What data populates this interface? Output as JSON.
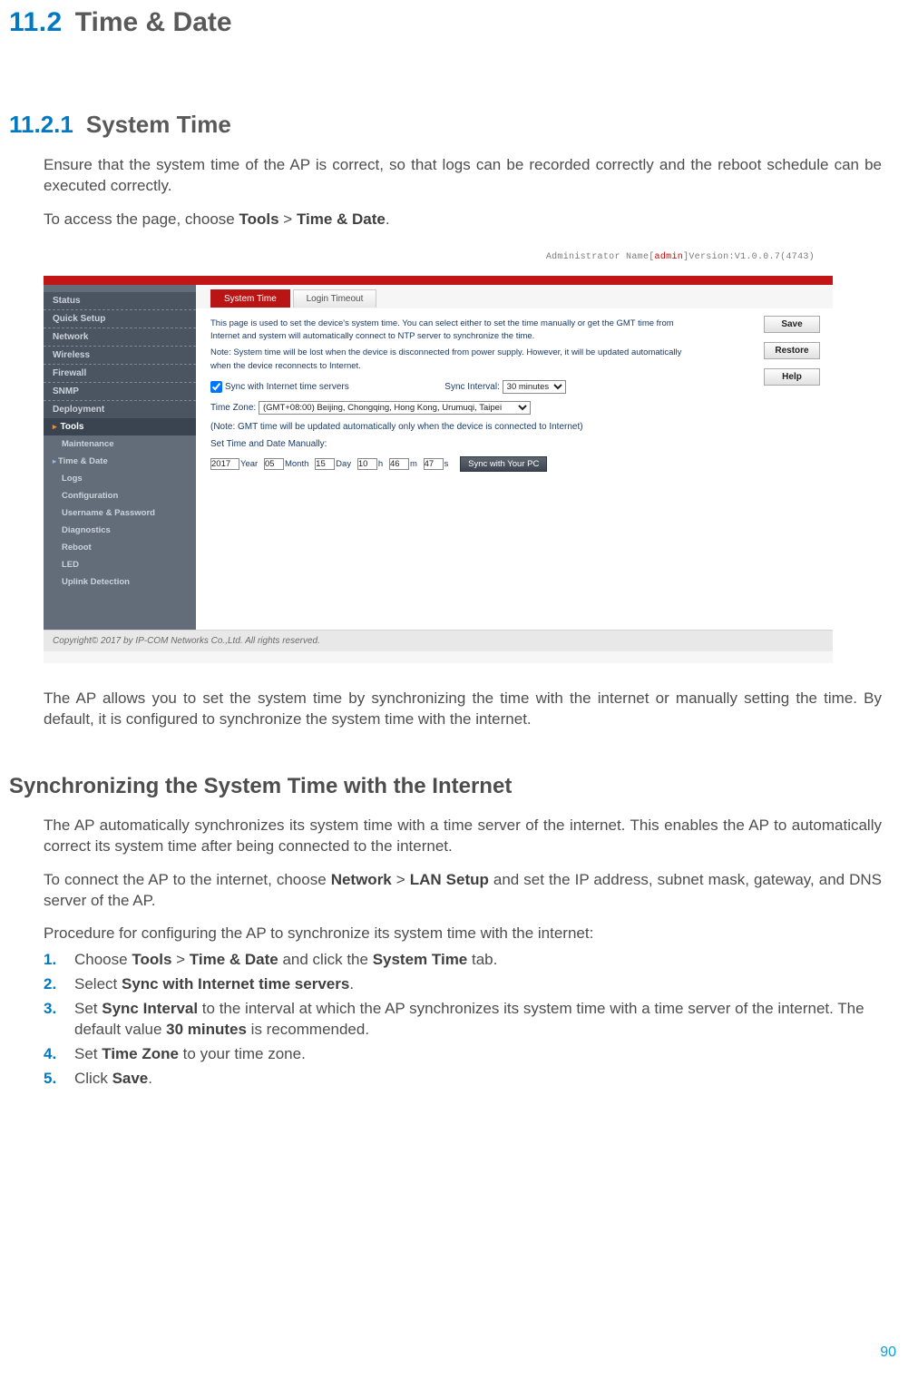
{
  "section": {
    "num": "11.2",
    "title": "Time & Date"
  },
  "subsection": {
    "num": "11.2.1",
    "title": "System Time"
  },
  "intro_p1": "Ensure that the system time of the AP is correct, so that logs can be recorded correctly and the reboot schedule can be executed correctly.",
  "intro_p2_pre": "To access the page, choose ",
  "intro_p2_b1": "Tools",
  "intro_p2_mid": " > ",
  "intro_p2_b2": "Time & Date",
  "intro_p2_post": ".",
  "after_shot": "The AP allows you to set the system time by synchronizing the time with the internet or manually setting the time. By default, it is configured to synchronize the system time with the internet.",
  "sync_heading": "Synchronizing the System Time with the Internet",
  "sync_p1": "The AP automatically synchronizes its system time with a time server of the internet. This enables the AP to automatically correct its system time after being connected to the internet.",
  "sync_p2_pre": "To connect the AP to the internet, choose ",
  "sync_p2_b1": "Network",
  "sync_p2_mid": " > ",
  "sync_p2_b2": "LAN Setup",
  "sync_p2_post": " and set the IP address, subnet mask, gateway, and DNS server of the AP.",
  "sync_p3": "Procedure for configuring the AP to synchronize its system time with the internet:",
  "steps": {
    "s1": {
      "n": "1.",
      "pre": "Choose ",
      "b1": "Tools",
      "mid1": " > ",
      "b2": "Time & Date",
      "mid2": " and click the ",
      "b3": "System Time",
      "post": " tab."
    },
    "s2": {
      "n": "2.",
      "pre": "Select ",
      "b1": "Sync with Internet time servers",
      "post": "."
    },
    "s3": {
      "n": "3.",
      "pre": "Set ",
      "b1": "Sync Interval",
      "mid": " to the interval at which the AP synchronizes its system time with a time server of the internet. The default value ",
      "b2": "30 minutes",
      "post": " is recommended."
    },
    "s4": {
      "n": "4.",
      "pre": "Set ",
      "b1": "Time Zone",
      "post": " to your time zone."
    },
    "s5": {
      "n": "5.",
      "pre": "Click ",
      "b1": "Save",
      "post": "."
    }
  },
  "page_number": "90",
  "shot": {
    "admin_label": "Administrator Name[",
    "admin_user": "admin",
    "admin_ver": "]Version:V1.0.0.7(4743)",
    "nav": {
      "status": "Status",
      "quick": "Quick Setup",
      "network": "Network",
      "wireless": "Wireless",
      "firewall": "Firewall",
      "snmp": "SNMP",
      "deployment": "Deployment",
      "tools": "Tools",
      "maintenance": "Maintenance",
      "timedate": "Time & Date",
      "logs": "Logs",
      "config": "Configuration",
      "userpass": "Username & Password",
      "diag": "Diagnostics",
      "reboot": "Reboot",
      "led": "LED",
      "uplink": "Uplink Detection"
    },
    "tabs": {
      "system_time": "System Time",
      "login_timeout": "Login Timeout"
    },
    "buttons": {
      "save": "Save",
      "restore": "Restore",
      "help": "Help",
      "sync_pc": "Sync with Your PC"
    },
    "desc1": "This page is used to set the device's system time. You can select either to set the time manually or get the GMT time from Internet and system will automatically connect to NTP server to synchronize the time.",
    "desc2": "Note: System time will be lost when the device is disconnected from power supply. However, it will be updated automatically when the device reconnects to Internet.",
    "sync_label": "Sync with Internet time servers",
    "sync_interval_label": "Sync Interval:",
    "sync_interval_value": "30 minutes",
    "tz_label": "Time Zone:",
    "tz_value": "(GMT+08:00) Beijing, Chongqing, Hong Kong, Urumuqi, Taipei",
    "tz_note": "(Note: GMT time will be updated automatically only when the device is connected to Internet)",
    "manual_label": "Set Time and Date Manually:",
    "dt": {
      "year": "2017",
      "year_u": "Year",
      "month": "05",
      "month_u": "Month",
      "day": "15",
      "day_u": "Day",
      "h": "10",
      "h_u": "h",
      "m": "46",
      "m_u": "m",
      "s": "47",
      "s_u": "s"
    },
    "copyright": "Copyright© 2017 by IP-COM Networks Co.,Ltd. All rights reserved."
  }
}
